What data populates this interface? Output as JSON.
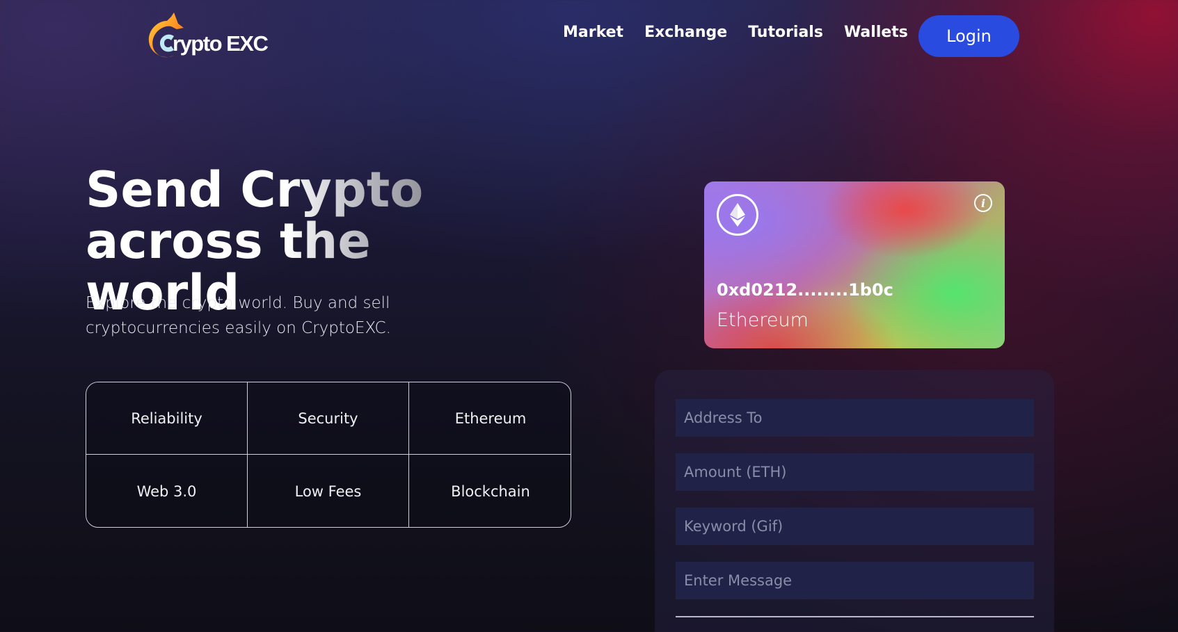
{
  "brand": {
    "name": "CryptoEXC",
    "logo_text": "rypto EXC"
  },
  "nav": {
    "items": [
      "Market",
      "Exchange",
      "Tutorials",
      "Wallets"
    ],
    "login_label": "Login"
  },
  "hero": {
    "title_line1": "Send Crypto",
    "title_line2": "across the world",
    "subtitle_line1": "Explore the crypto world. Buy and sell",
    "subtitle_line2": "cryptocurrencies easily on CryptoEXC."
  },
  "features": [
    "Reliability",
    "Security",
    "Ethereum",
    "Web 3.0",
    "Low Fees",
    "Blockchain"
  ],
  "card": {
    "address": "0xd0212........1b0c",
    "network": "Ethereum",
    "icon": "ethereum-icon"
  },
  "form": {
    "address_placeholder": "Address To",
    "amount_placeholder": "Amount (ETH)",
    "keyword_placeholder": "Keyword (Gif)",
    "message_placeholder": "Enter Message"
  },
  "colors": {
    "accent": "#2a4be0",
    "field_bg": "#202248"
  }
}
